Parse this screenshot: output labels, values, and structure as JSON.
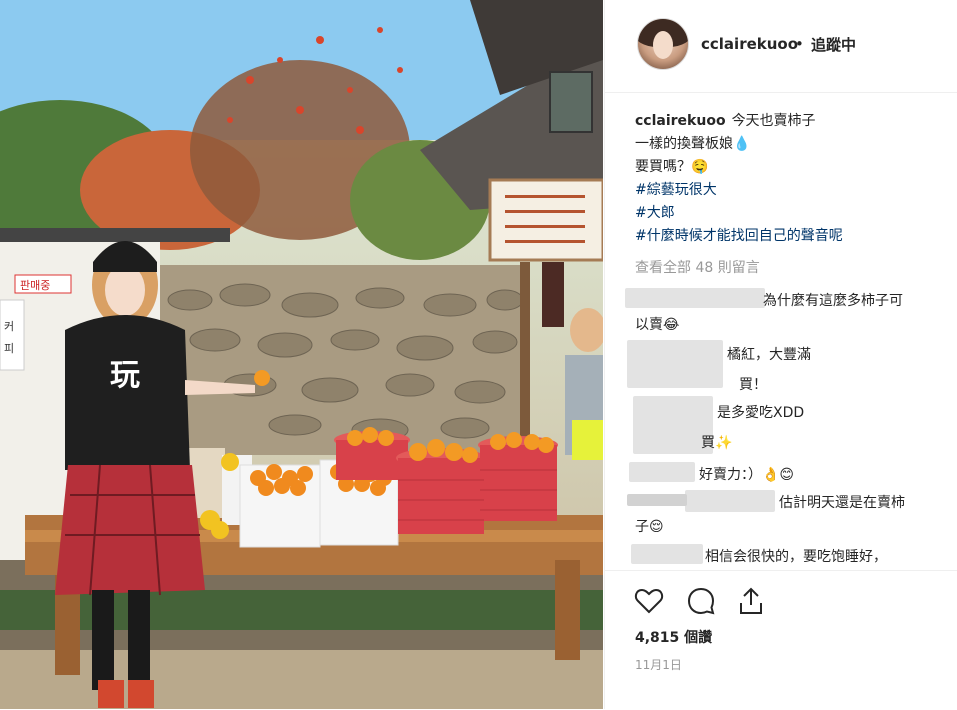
{
  "post": {
    "username": "cclairekuoo",
    "separator": "•",
    "follow_label": "追蹤中",
    "caption": {
      "username": "cclairekuoo",
      "text_line1": "今天也賣柿子",
      "text_line2": "一樣的換聲板娘💧",
      "text_line3": "要買嗎？🤤",
      "hashtags": [
        "#綜藝玩很大",
        "#大郎",
        "#什麼時候才能找回自己的聲音呢"
      ]
    },
    "view_all_comments": "查看全部 48 則留言",
    "comments": [
      {
        "text": "為什麼有這麼多柿子可"
      },
      {
        "text": "以賣😂"
      },
      {
        "text": "橘紅，大豐滿"
      },
      {
        "text": "買！"
      },
      {
        "text": "是多愛吃XDD"
      },
      {
        "text": "買✨"
      },
      {
        "text": "好賣力：）👌😊"
      },
      {
        "text": "估計明天還是在賣柿"
      },
      {
        "text": "子😌"
      },
      {
        "text": "相信会很快的，要吃饱睡好，"
      }
    ],
    "likes": "4,815 個讚",
    "date": "11月1日",
    "photo_signs": {
      "shop_sign_left": "판매중",
      "shop_sign_left2": "커피",
      "sweatshirt_text": "玩"
    }
  },
  "colors": {
    "hashtag": "#003569",
    "muted": "#999999",
    "text": "#262626"
  }
}
